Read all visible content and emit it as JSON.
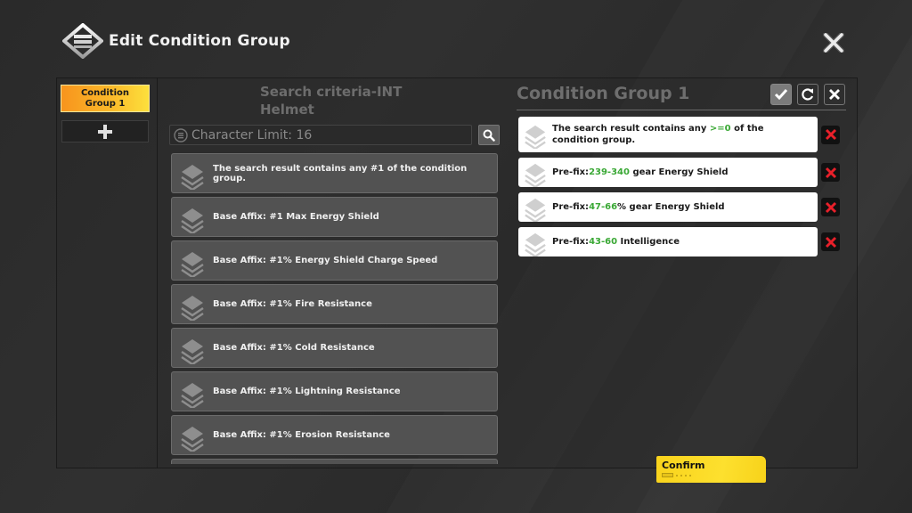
{
  "header": {
    "title": "Edit Condition Group"
  },
  "sidebar": {
    "groups": [
      {
        "label": "Condition Group 1",
        "active": true
      }
    ],
    "add_label": "+"
  },
  "search": {
    "title": "Search criteria-INT Helmet",
    "placeholder": "Character Limit: 16",
    "value": ""
  },
  "results": [
    {
      "label": "The search result contains any #1 of the condition group."
    },
    {
      "label": "Base Affix: #1 Max Energy Shield"
    },
    {
      "label": "Base Affix: #1% Energy Shield Charge Speed"
    },
    {
      "label": "Base Affix: #1% Fire Resistance"
    },
    {
      "label": "Base Affix: #1% Cold Resistance"
    },
    {
      "label": "Base Affix: #1% Lightning Resistance"
    },
    {
      "label": "Base Affix: #1% Erosion Resistance"
    }
  ],
  "condition_group": {
    "title": "Condition Group 1",
    "conditions": [
      {
        "prefix": "The search result contains any ",
        "value": ">=0",
        "suffix": " of the condition group."
      },
      {
        "prefix": "Pre-fix:",
        "value": "239-340",
        "suffix": " gear Energy Shield"
      },
      {
        "prefix": "Pre-fix:",
        "value": "47-66",
        "suffix": "% gear Energy Shield"
      },
      {
        "prefix": "Pre-fix:",
        "value": "43-60",
        "suffix": " Intelligence"
      }
    ]
  },
  "footer": {
    "confirm_label": "Confirm"
  },
  "colors": {
    "accent_yellow": "#fde02e",
    "tab_orange": "#f7941d",
    "value_green": "#3aa835",
    "delete_red": "#e8202a"
  }
}
